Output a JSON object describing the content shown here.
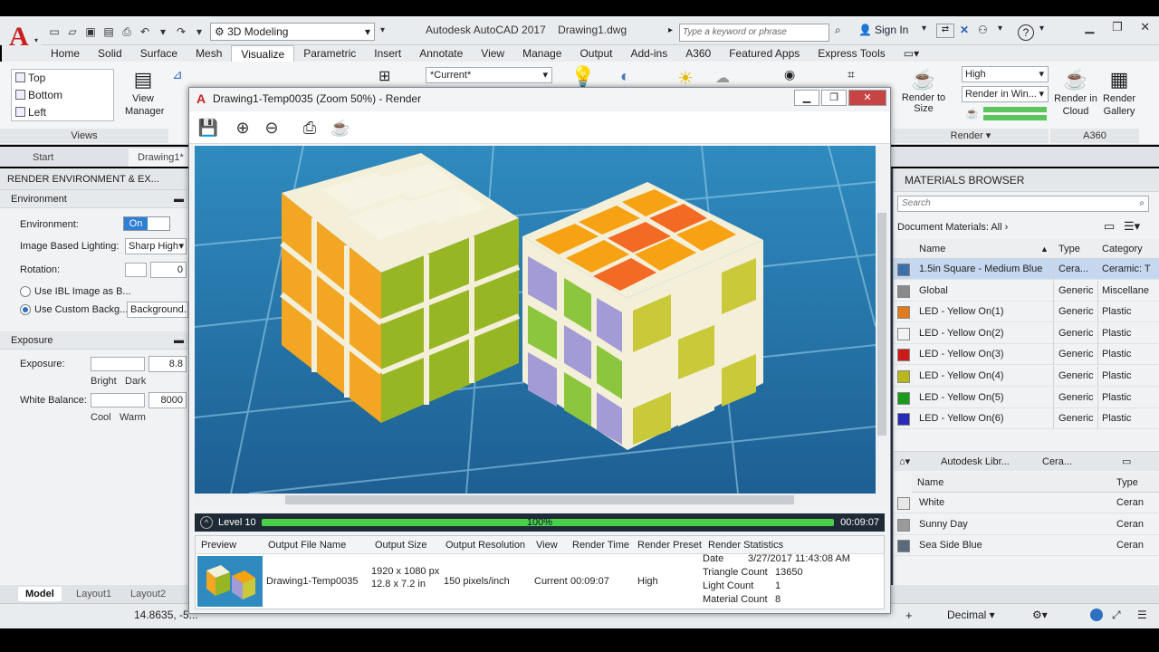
{
  "app": {
    "title": "Autodesk AutoCAD 2017",
    "file": "Drawing1.dwg",
    "workspace": "3D Modeling",
    "search_placeholder": "Type a keyword or phrase",
    "sign_in": "Sign In",
    "help": "?"
  },
  "ribbon_tabs": [
    "Home",
    "Solid",
    "Surface",
    "Mesh",
    "Visualize",
    "Parametric",
    "Insert",
    "Annotate",
    "View",
    "Manage",
    "Output",
    "Add-ins",
    "A360",
    "Featured Apps",
    "Express Tools"
  ],
  "ribbon": {
    "views": {
      "items": [
        "Top",
        "Bottom",
        "Left"
      ],
      "title": "Views",
      "view_manager_line1": "View",
      "view_manager_line2": "Manager"
    },
    "current_view": "*Current*",
    "render_quality": "High",
    "render_target": "Render in Win...",
    "render_to_size": "Render to Size",
    "render_cloud_line1": "Render in",
    "render_cloud_line2": "Cloud",
    "render_gallery_line1": "Render",
    "render_gallery_line2": "Gallery",
    "render_title": "Render",
    "a360_title": "A360"
  },
  "file_tabs": {
    "start": "Start",
    "drawing": "Drawing1*"
  },
  "left_panel": {
    "title": "RENDER ENVIRONMENT & EX...",
    "environment_section": "Environment",
    "environment_label": "Environment:",
    "environment_state": "On",
    "ibl_label": "Image Based Lighting:",
    "ibl_value": "Sharp Highl",
    "rotation_label": "Rotation:",
    "rotation_value": "0",
    "use_ibl": "Use IBL Image as B...",
    "use_custom": "Use Custom Backg...",
    "background_btn": "Background...",
    "exposure_section": "Exposure",
    "exposure_label": "Exposure:",
    "exposure_value": "8.8",
    "bright": "Bright",
    "dark": "Dark",
    "white_balance_label": "White Balance:",
    "white_balance_value": "8000",
    "cool": "Cool",
    "warm": "Warm"
  },
  "layout_tabs": [
    "Model",
    "Layout1",
    "Layout2"
  ],
  "status": {
    "coords": "14.8635, -5...",
    "units": "Decimal"
  },
  "materials": {
    "title": "MATERIALS BROWSER",
    "search_placeholder": "Search",
    "doc_filter": "Document Materials: All",
    "columns": [
      "Name",
      "Type",
      "Category"
    ],
    "rows": [
      {
        "name": "1.5in Square - Medium Blue",
        "type": "Cera...",
        "category": "Ceramic: T",
        "swatch": "#3d6fa8",
        "selected": true
      },
      {
        "name": "Global",
        "type": "Generic",
        "category": "Miscellane",
        "swatch": "#8a8a8a",
        "selected": false
      },
      {
        "name": "LED - Yellow On(1)",
        "type": "Generic",
        "category": "Plastic",
        "swatch": "#e07a1a",
        "selected": false
      },
      {
        "name": "LED - Yellow On(2)",
        "type": "Generic",
        "category": "Plastic",
        "swatch": "#f2f2f2",
        "selected": false
      },
      {
        "name": "LED - Yellow On(3)",
        "type": "Generic",
        "category": "Plastic",
        "swatch": "#cc1a1a",
        "selected": false
      },
      {
        "name": "LED - Yellow On(4)",
        "type": "Generic",
        "category": "Plastic",
        "swatch": "#b8b81a",
        "selected": false
      },
      {
        "name": "LED - Yellow On(5)",
        "type": "Generic",
        "category": "Plastic",
        "swatch": "#1a9a1a",
        "selected": false
      },
      {
        "name": "LED - Yellow On(6)",
        "type": "Generic",
        "category": "Plastic",
        "swatch": "#2a2ab8",
        "selected": false
      }
    ],
    "library_path": [
      "Autodesk Libr...",
      "Cera..."
    ],
    "lib_columns": [
      "Name",
      "Type"
    ],
    "lib_rows": [
      {
        "name": "White",
        "type": "Ceran",
        "swatch": "#e8e8e8"
      },
      {
        "name": "Sunny Day",
        "type": "Ceran",
        "swatch": "#9a9a9a"
      },
      {
        "name": "Sea Side Blue",
        "type": "Ceran",
        "swatch": "#5a6a7a"
      }
    ]
  },
  "render_window": {
    "title": "Drawing1-Temp0035 (Zoom 50%) - Render",
    "level": "Level 10",
    "percent": "100%",
    "progress": 1.0,
    "elapsed": "00:09:07",
    "columns": [
      "Preview",
      "Output File Name",
      "Output Size",
      "Output Resolution",
      "View",
      "Render Time",
      "Render Preset",
      "Render Statistics"
    ],
    "entry": {
      "file": "Drawing1-Temp0035",
      "size_line1": "1920 x 1080 px",
      "size_line2": "12.8 x 7.2 in",
      "resolution": "150 pixels/inch",
      "view": "Current",
      "time": "00:09:07",
      "preset": "High",
      "stats": [
        {
          "label": "Date",
          "value": "3/27/2017 11:43:08 AM"
        },
        {
          "label": "Triangle Count",
          "value": "13650"
        },
        {
          "label": "Light Count",
          "value": "1"
        },
        {
          "label": "Material Count",
          "value": "8"
        }
      ]
    }
  },
  "colors": {
    "accent": "#2f7fd2",
    "progress": "#4ad14a",
    "autocad_red": "#c8211f"
  }
}
